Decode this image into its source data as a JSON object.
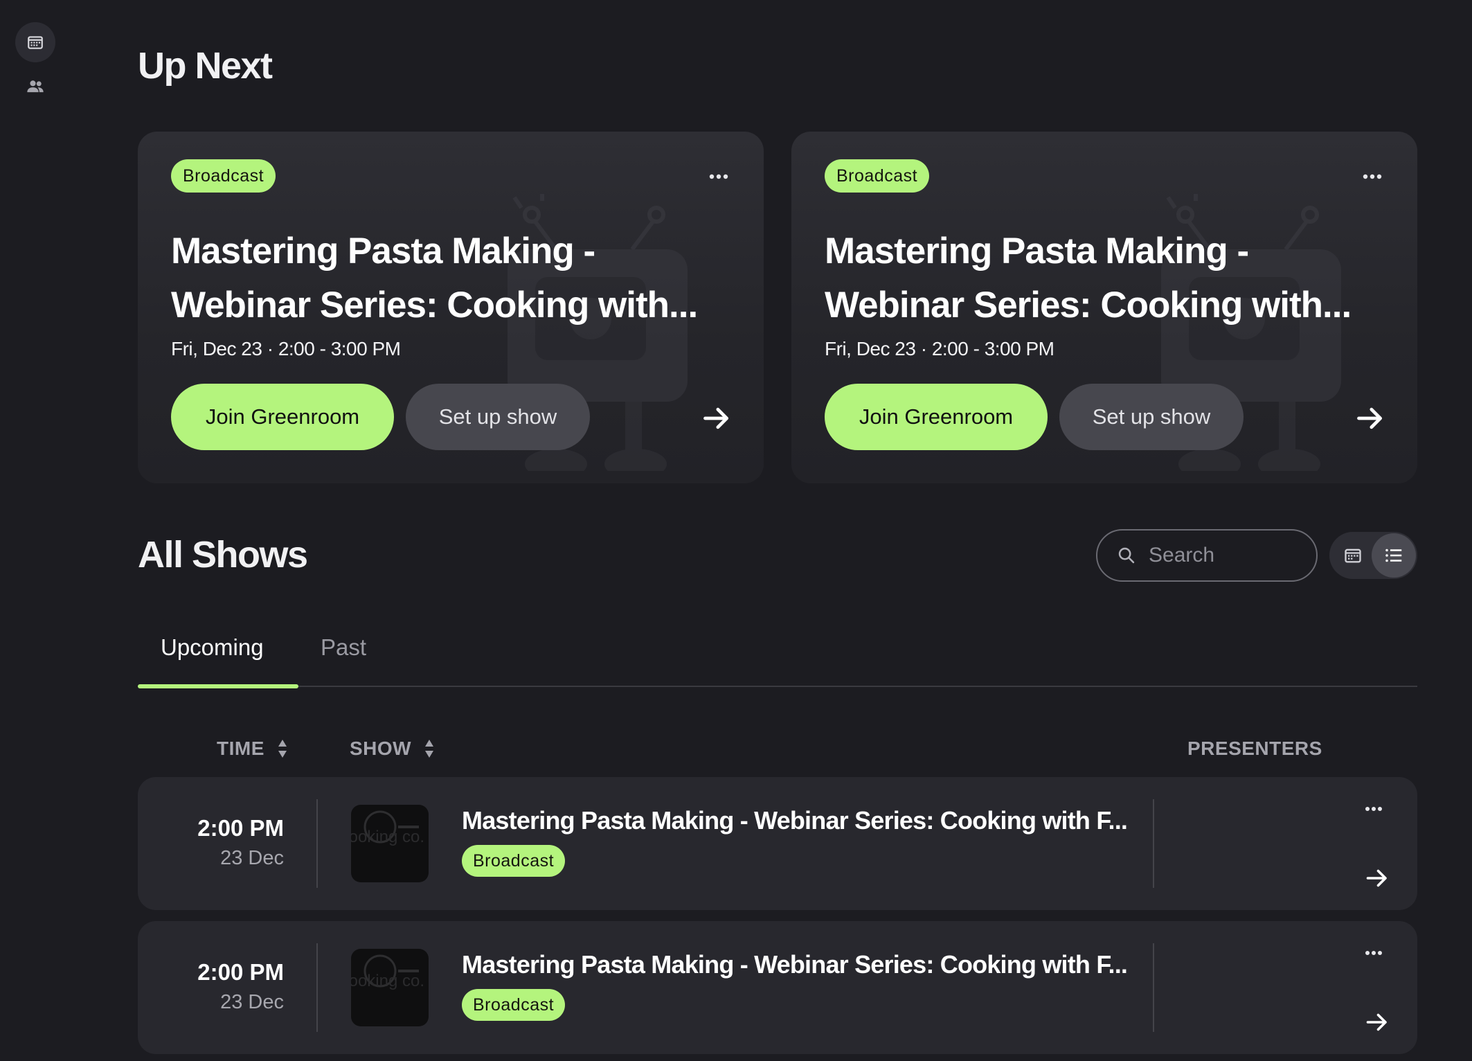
{
  "sidebar": {
    "items": [
      {
        "icon": "calendar-icon",
        "active": true
      },
      {
        "icon": "people-icon",
        "active": false
      }
    ]
  },
  "up_next": {
    "heading": "Up Next",
    "cards": [
      {
        "badge": "Broadcast",
        "title": "Mastering Pasta Making - Webinar Series: Cooking with...",
        "date": "Fri, Dec 23",
        "time": "2:00 - 3:00 PM",
        "join_label": "Join Greenroom",
        "setup_label": "Set up show"
      },
      {
        "badge": "Broadcast",
        "title": "Mastering Pasta Making - Webinar Series: Cooking with...",
        "date": "Fri, Dec 23",
        "time": "2:00 - 3:00 PM",
        "join_label": "Join Greenroom",
        "setup_label": "Set up show"
      }
    ]
  },
  "all_shows": {
    "heading": "All Shows",
    "search_placeholder": "Search",
    "view_toggle": {
      "options": [
        "calendar-view",
        "list-view"
      ],
      "selected": "list-view"
    },
    "tabs": [
      {
        "label": "Upcoming",
        "active": true
      },
      {
        "label": "Past",
        "active": false
      }
    ],
    "columns": {
      "time": "TIME",
      "show": "SHOW",
      "presenters": "PRESENTERS"
    },
    "rows": [
      {
        "time": "2:00 PM",
        "date": "23 Dec",
        "title": "Mastering Pasta Making - Webinar Series: Cooking with F...",
        "badge": "Broadcast",
        "thumb_text": "the cooking co."
      },
      {
        "time": "2:00 PM",
        "date": "23 Dec",
        "title": "Mastering Pasta Making - Webinar Series: Cooking with F...",
        "badge": "Broadcast",
        "thumb_text": "the cooking co."
      }
    ]
  },
  "colors": {
    "background": "#1c1c21",
    "accent": "#b4f47d",
    "card": "#28282e"
  }
}
